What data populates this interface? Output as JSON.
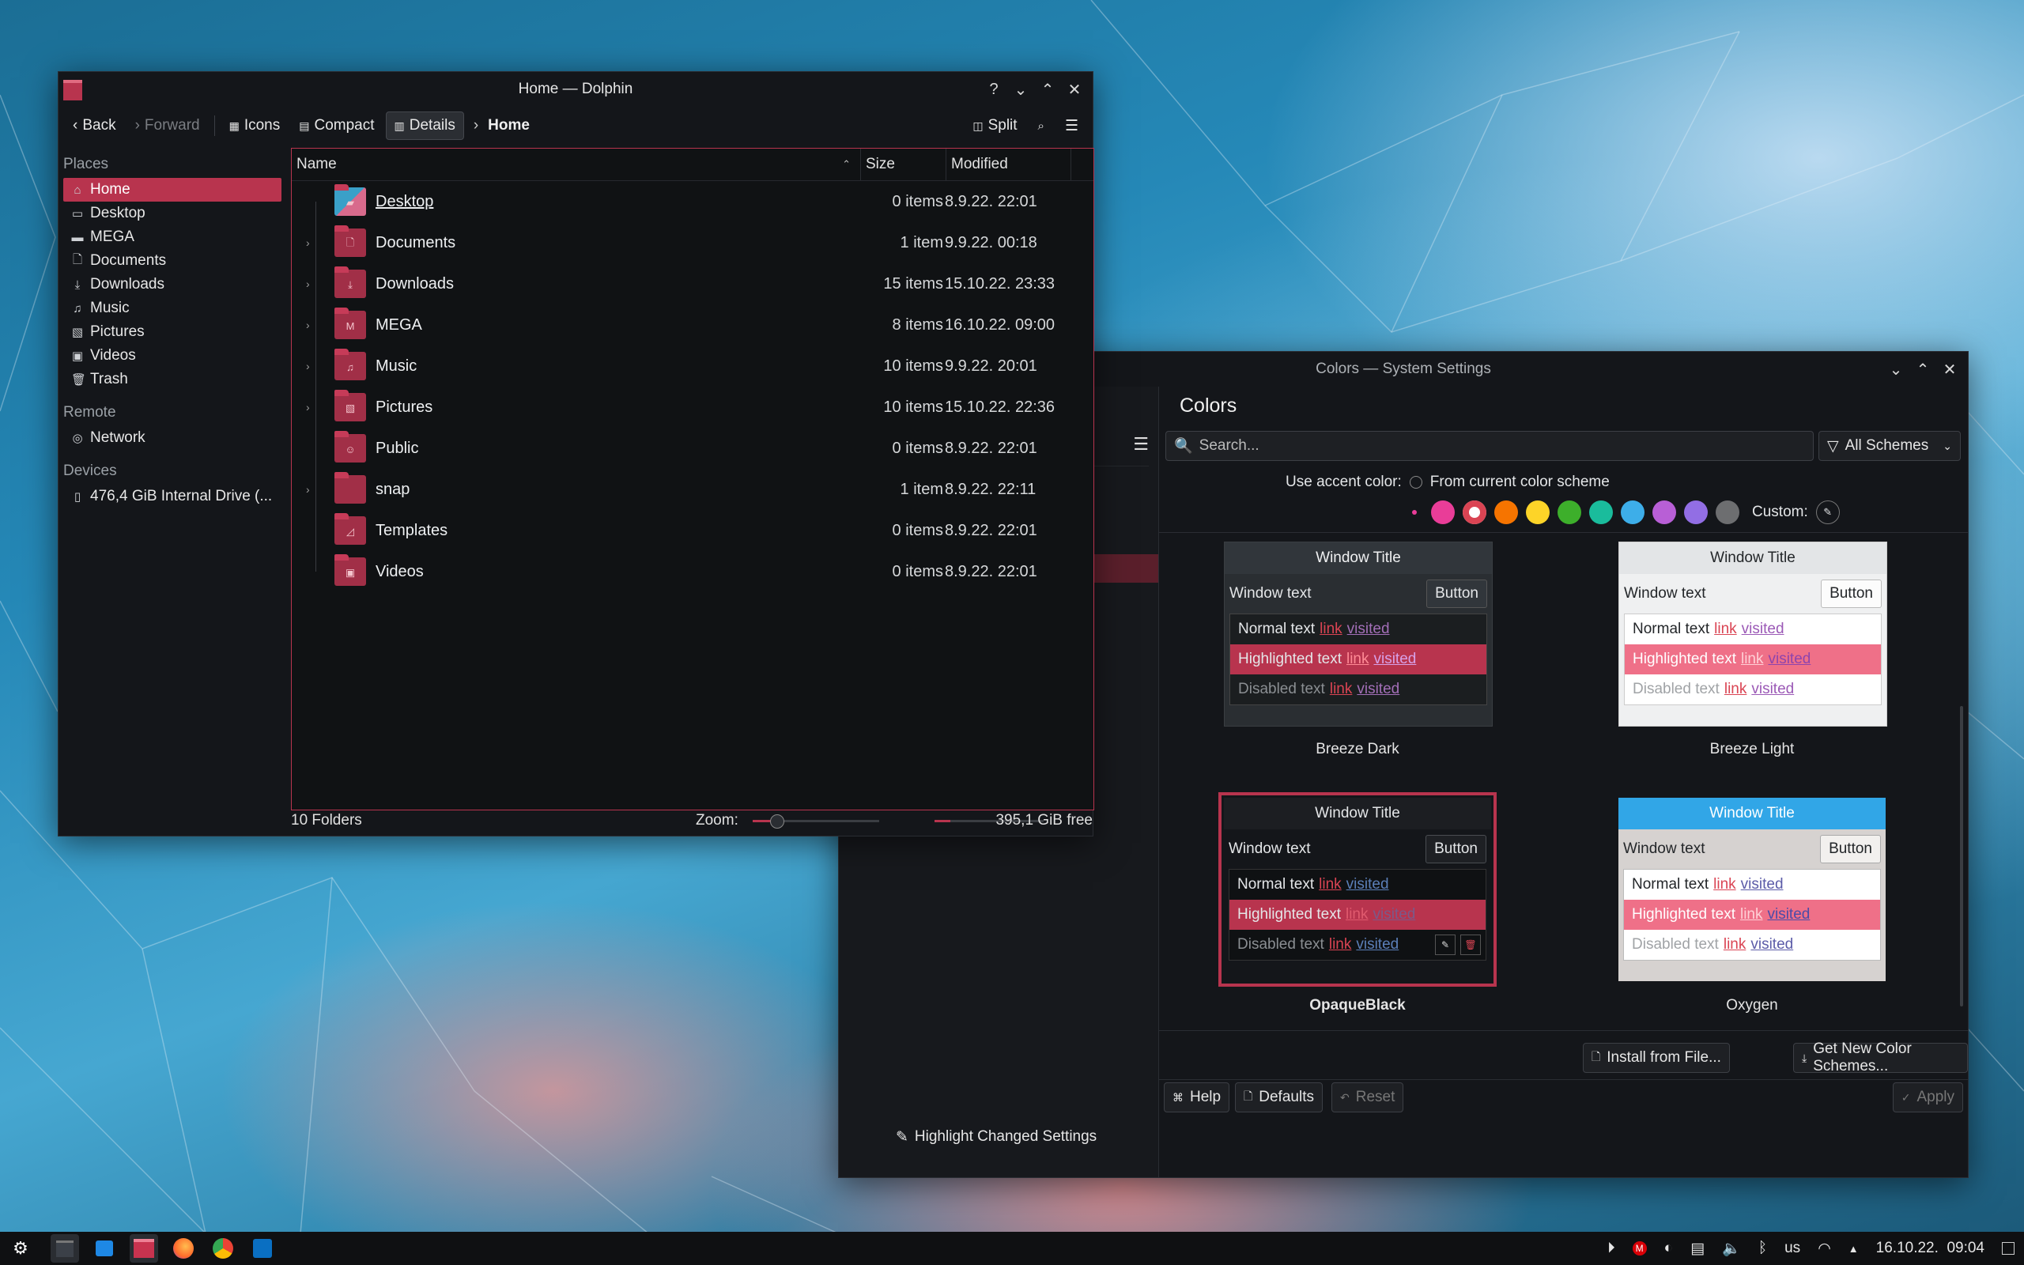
{
  "dolphin": {
    "title": "Home — Dolphin",
    "toolbar": {
      "back": "Back",
      "forward": "Forward",
      "icons": "Icons",
      "compact": "Compact",
      "details": "Details",
      "breadcrumb": "Home",
      "split": "Split"
    },
    "places": {
      "heading": "Places",
      "items": [
        "Home",
        "Desktop",
        "MEGA",
        "Documents",
        "Downloads",
        "Music",
        "Pictures",
        "Videos",
        "Trash"
      ],
      "remote_heading": "Remote",
      "remote_items": [
        "Network"
      ],
      "devices_heading": "Devices",
      "device_items": [
        "476,4 GiB Internal Drive (..."
      ]
    },
    "columns": {
      "name": "Name",
      "size": "Size",
      "modified": "Modified"
    },
    "files": [
      {
        "name": "Desktop",
        "size": "0 items",
        "modified": "8.9.22. 22:01",
        "expandable": false
      },
      {
        "name": "Documents",
        "size": "1 item",
        "modified": "9.9.22. 00:18",
        "expandable": true
      },
      {
        "name": "Downloads",
        "size": "15 items",
        "modified": "15.10.22. 23:33",
        "expandable": true
      },
      {
        "name": "MEGA",
        "size": "8 items",
        "modified": "16.10.22. 09:00",
        "expandable": true
      },
      {
        "name": "Music",
        "size": "10 items",
        "modified": "9.9.22. 20:01",
        "expandable": true
      },
      {
        "name": "Pictures",
        "size": "10 items",
        "modified": "15.10.22. 22:36",
        "expandable": true
      },
      {
        "name": "Public",
        "size": "0 items",
        "modified": "8.9.22. 22:01",
        "expandable": false
      },
      {
        "name": "snap",
        "size": "1 item",
        "modified": "8.9.22. 22:11",
        "expandable": true
      },
      {
        "name": "Templates",
        "size": "0 items",
        "modified": "8.9.22. 22:01",
        "expandable": false
      },
      {
        "name": "Videos",
        "size": "0 items",
        "modified": "8.9.22. 22:01",
        "expandable": false
      }
    ],
    "status": {
      "folders": "10 Folders",
      "zoom_label": "Zoom:",
      "free": "395,1 GiB free"
    }
  },
  "settings": {
    "title": "Colors — System Settings",
    "page_title": "Colors",
    "search_placeholder": "Search...",
    "scheme_filter": "All Schemes",
    "accent_label": "Use accent color:",
    "accent_option": "From current color scheme",
    "custom_label": "Custom:",
    "accent_colors": [
      "#e93d98",
      "#da4453",
      "#f67400",
      "#fdd428",
      "#3daf2b",
      "#1abc9c",
      "#3daee9",
      "#b85fd6",
      "#926ee4",
      "#6d6e70"
    ],
    "preview": {
      "window_title": "Window Title",
      "window_text": "Window text",
      "button": "Button",
      "normal": "Normal text",
      "highlighted": "Highlighted text",
      "disabled": "Disabled text",
      "link": "link",
      "visited": "visited"
    },
    "schemes": [
      "Breeze Dark",
      "Breeze Light",
      "OpaqueBlack",
      "Oxygen"
    ],
    "install_button": "Install from File...",
    "get_new_button": "Get New Color Schemes...",
    "highlight_button": "Highlight Changed Settings",
    "help_button": "Help",
    "defaults_button": "Defaults",
    "reset_button": "Reset",
    "apply_button": "Apply"
  },
  "tray": {
    "keyboard": "us",
    "datetime": "16.10.22.  09:04"
  }
}
